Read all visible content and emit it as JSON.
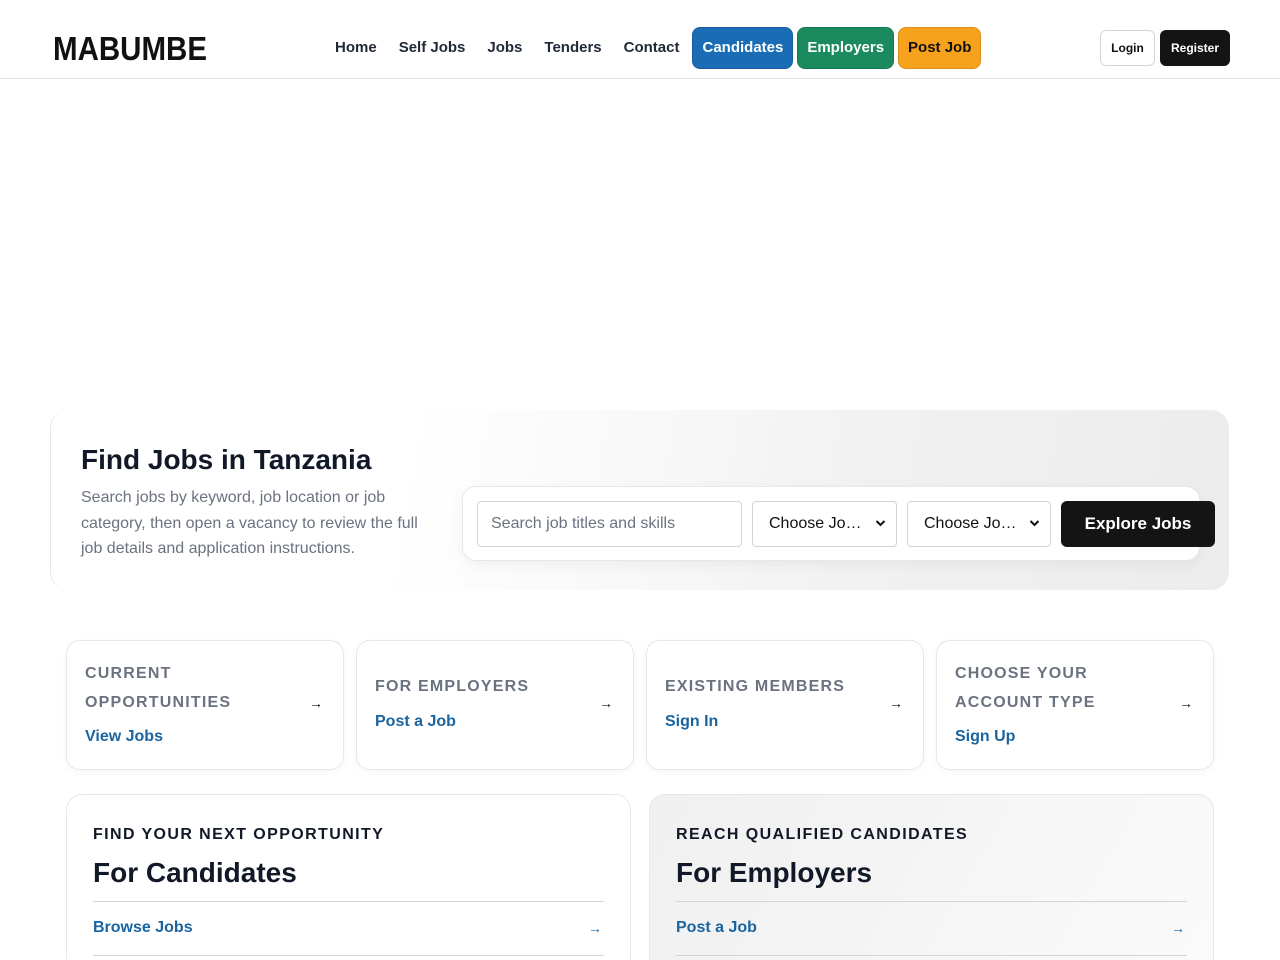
{
  "header": {
    "logo_text": "MABUMBE",
    "nav": [
      {
        "label": "Home"
      },
      {
        "label": "Self Jobs"
      },
      {
        "label": "Jobs"
      },
      {
        "label": "Tenders"
      },
      {
        "label": "Contact"
      }
    ],
    "pills": {
      "candidates": "Candidates",
      "employers": "Employers",
      "post_job": "Post Job"
    },
    "login": "Login",
    "register": "Register"
  },
  "hero": {
    "title": "Find Jobs in Tanzania",
    "description": "Search jobs by keyword, job location or job category, then open a vacancy to review the full job details and application instructions.",
    "search_placeholder": "Search job titles and skills",
    "select_location": "Choose Job Location",
    "select_category": "Choose Job Category",
    "explore_button": "Explore Jobs"
  },
  "quick_cards": [
    {
      "eyebrow": "Current Opportunities",
      "link": "View Jobs",
      "arrow": "→"
    },
    {
      "eyebrow": "For Employers",
      "link": "Post a Job",
      "arrow": "→"
    },
    {
      "eyebrow": "Existing Members",
      "link": "Sign In",
      "arrow": "→"
    },
    {
      "eyebrow": "Choose Your Account Type",
      "link": "Sign Up",
      "arrow": "→"
    }
  ],
  "panels": {
    "candidates": {
      "eyebrow": "FIND YOUR NEXT OPPORTUNITY",
      "title": "For Candidates",
      "link": "Browse Jobs",
      "arrow": "→"
    },
    "employers": {
      "eyebrow": "REACH QUALIFIED CANDIDATES",
      "title": "For Employers",
      "link": "Post a Job",
      "arrow": "→"
    }
  },
  "colors": {
    "candidates_pill": "#1a6cb5",
    "employers_pill": "#1b8a5f",
    "post_job_pill": "#f6a21c",
    "link_blue": "#1a64a0",
    "dark_button": "#141414"
  }
}
